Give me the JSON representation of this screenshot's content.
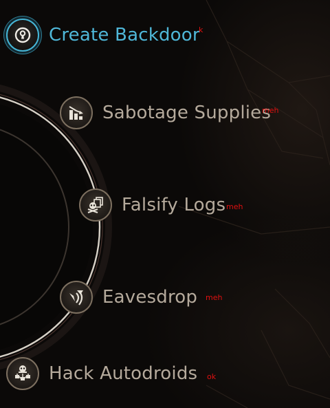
{
  "menu": {
    "items": [
      {
        "label": "Create Backdoor",
        "note": "k",
        "icon": "keyhole-icon",
        "active": true
      },
      {
        "label": "Sabotage Supplies",
        "note": "meh",
        "icon": "declining-chart-icon",
        "active": false
      },
      {
        "label": "Falsify Logs",
        "note": "meh",
        "icon": "skull-crossbones-documents-icon",
        "active": false
      },
      {
        "label": "Eavesdrop",
        "note": "meh",
        "icon": "signal-listen-icon",
        "active": false
      },
      {
        "label": "Hack Autodroids",
        "note": "ok",
        "icon": "skull-circuit-icon",
        "active": false
      }
    ]
  },
  "colors": {
    "active_accent": "#4fb7d8",
    "label_text": "#b5aa9c",
    "icon_border": "#7d7060",
    "note_text": "#e01010"
  }
}
